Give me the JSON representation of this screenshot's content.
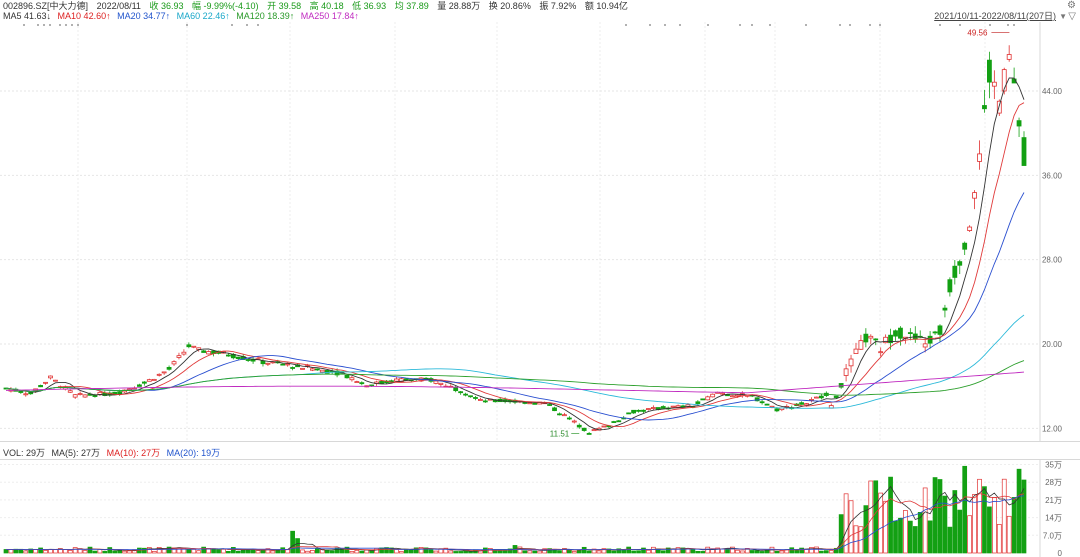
{
  "header": {
    "symbol": "002896.SZ[中大力德]",
    "date": "2022/08/11",
    "close": "收 36.93",
    "change": "幅 -9.99%(-4.10)",
    "open": "开 39.58",
    "high": "高 40.18",
    "low": "低 36.93",
    "avg": "均 37.89",
    "volume": "量 28.88万",
    "turnover": "换 20.86%",
    "amplitude": "振 7.92%",
    "amount": "额 10.94亿"
  },
  "ma_legend": {
    "ma5": "MA5 41.63↓",
    "ma10": "MA10 42.60↑",
    "ma20": "MA20 34.77↑",
    "ma60": "MA60 22.46↑",
    "ma120": "MA120 18.39↑",
    "ma250": "MA250 17.84↑"
  },
  "date_range": "2021/10/11-2022/08/11(207日)",
  "price_axis": [
    "44.00",
    "36.00",
    "28.00",
    "20.00",
    "12.00"
  ],
  "annotations": {
    "high": "49.56",
    "low": "11.51"
  },
  "volume_header": {
    "vol": "VOL: 29万",
    "ma5": "MA(5): 27万",
    "ma10": "MA(10): 27万",
    "ma20": "MA(20): 19万"
  },
  "volume_axis": [
    "35万",
    "28万",
    "21万",
    "14万",
    "7.0万",
    "0"
  ],
  "colors": {
    "up": "#e03030",
    "down": "#13a013",
    "ma5": "#333333",
    "ma10": "#e03a3a",
    "ma20": "#2a4fd0",
    "ma60": "#2bb9d9",
    "ma120": "#2ea02e",
    "ma250": "#c02bc0"
  },
  "icons": [
    "settings-icon",
    "collapse-icon",
    "dropdown-icon"
  ],
  "chart_data": {
    "type": "candlestick",
    "x": [
      "2021/10/11",
      "2022/08/11"
    ],
    "ylim": [
      11.51,
      49.56
    ],
    "last": {
      "date": "2022/08/11",
      "open": 39.58,
      "high": 40.18,
      "low": 36.93,
      "close": 36.93
    },
    "series": [
      {
        "name": "MA5",
        "value": 41.63
      },
      {
        "name": "MA10",
        "value": 42.6
      },
      {
        "name": "MA20",
        "value": 34.77
      },
      {
        "name": "MA60",
        "value": 22.46
      },
      {
        "name": "MA120",
        "value": 18.39
      },
      {
        "name": "MA250",
        "value": 17.84
      }
    ]
  }
}
